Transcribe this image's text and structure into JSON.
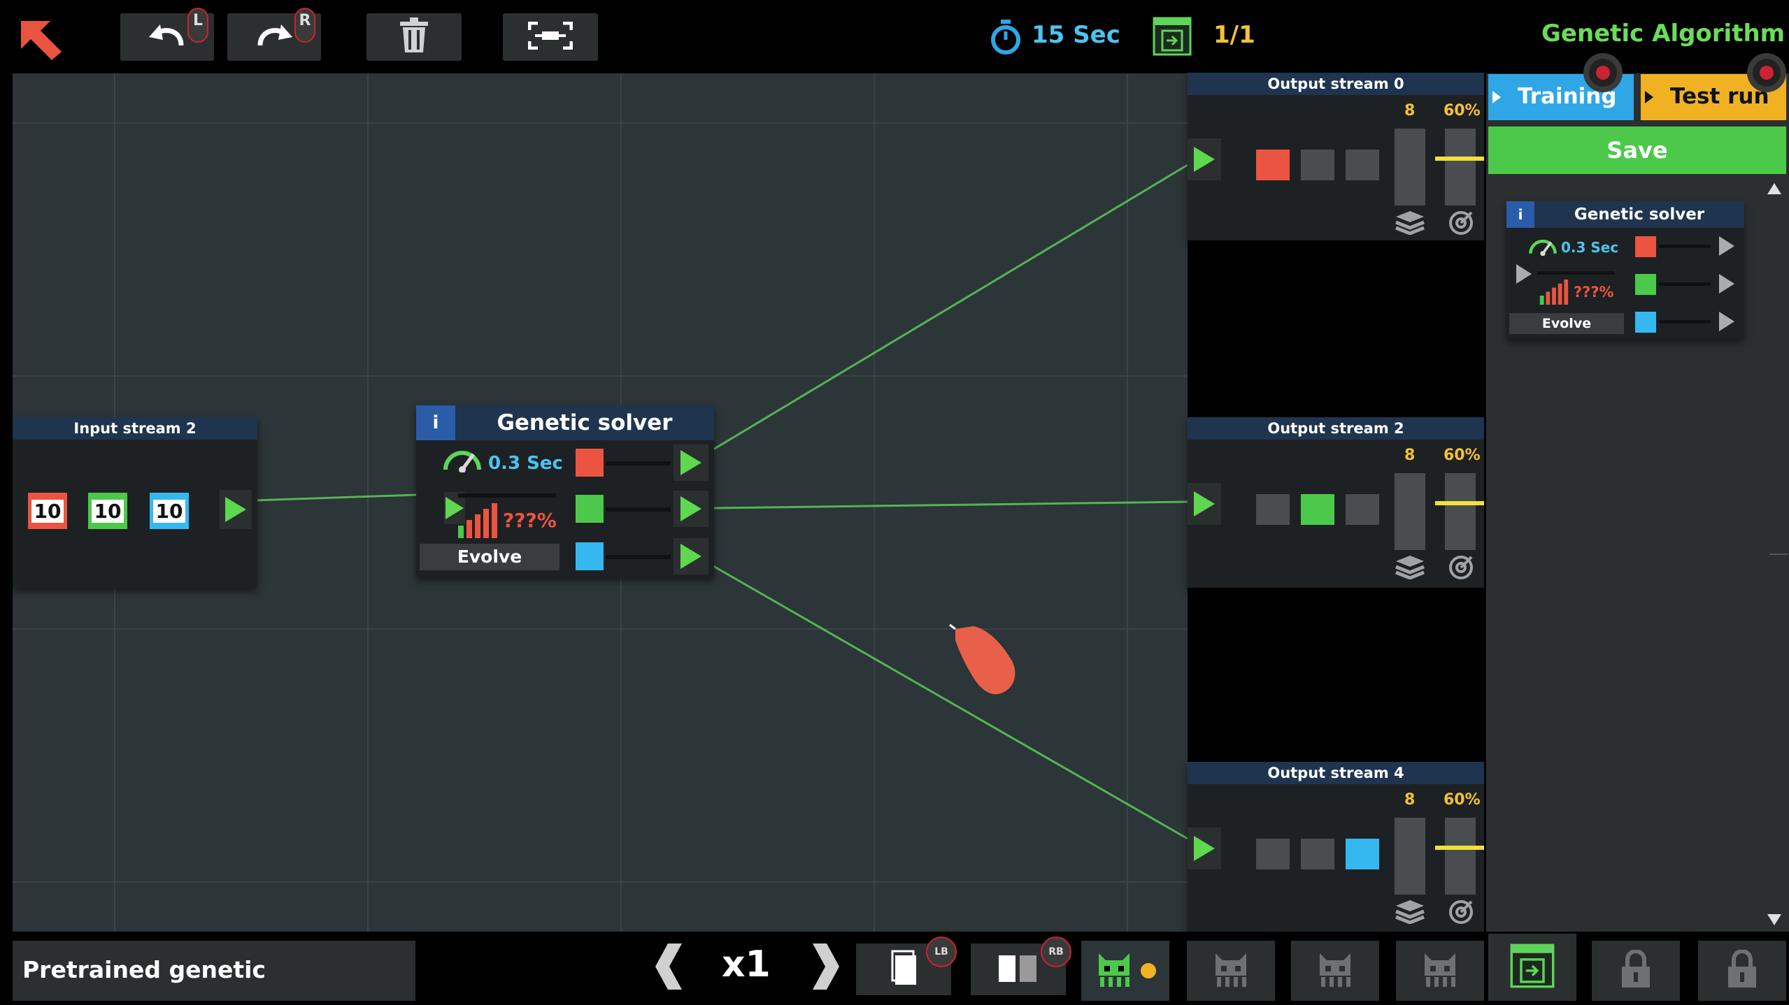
{
  "toolbar": {
    "undo_badge": "L",
    "redo_badge": "R",
    "timer": "15 Sec",
    "level_progress": "1/1",
    "title": "Genetic Algorithm"
  },
  "tabs": {
    "training": "Training",
    "test_run": "Test run",
    "save": "Save"
  },
  "input_node": {
    "title": "Input stream 2",
    "values": [
      "10",
      "10",
      "10"
    ]
  },
  "solver_node": {
    "info": "i",
    "title": "Genetic solver",
    "speed": "0.3 Sec",
    "accuracy": "???%",
    "evolve": "Evolve"
  },
  "outputs": [
    {
      "title": "Output stream 0",
      "count": "8",
      "percent": "60%"
    },
    {
      "title": "Output stream 2",
      "count": "8",
      "percent": "60%"
    },
    {
      "title": "Output stream 4",
      "count": "8",
      "percent": "60%"
    }
  ],
  "panel_card": {
    "info": "i",
    "title": "Genetic solver",
    "speed": "0.3 Sec",
    "accuracy": "???%",
    "evolve": "Evolve"
  },
  "bottom": {
    "level_name": "Pretrained genetic",
    "speed": "x1",
    "lb_badge": "LB",
    "rb_badge": "RB"
  },
  "colors": {
    "red": "#ea5441",
    "green": "#4cc94a",
    "blue": "#35b8f0",
    "wire": "#5fd45a",
    "accent_green": "#6bdc5a"
  },
  "icons": [
    "back-arrow-icon",
    "undo-icon",
    "redo-icon",
    "trash-icon",
    "fit-view-icon",
    "stopwatch-icon",
    "level-icon",
    "speed-gauge-icon",
    "bar-chart-icon",
    "layers-icon",
    "target-icon",
    "hand-cursor-icon",
    "card-single-icon",
    "card-double-icon",
    "robot-icon",
    "lock-icon"
  ]
}
